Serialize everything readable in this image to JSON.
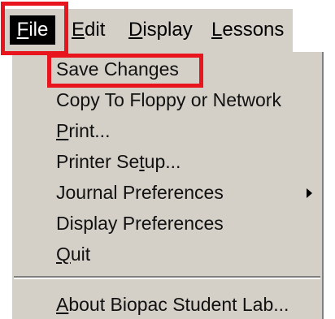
{
  "menubar": {
    "items": [
      {
        "label": "File",
        "accel_first": "F",
        "rest": "ile"
      },
      {
        "label": "Edit",
        "accel_first": "E",
        "rest": "dit"
      },
      {
        "label": "Display",
        "accel_first": "D",
        "rest": "isplay"
      },
      {
        "label": "Lessons",
        "accel_first": "L",
        "rest": "essons"
      }
    ]
  },
  "file_menu": {
    "items": [
      {
        "label": "Save Changes"
      },
      {
        "label": "Copy To Floppy or Network"
      },
      {
        "label": "Print...",
        "accel_first": "P",
        "rest": "rint..."
      },
      {
        "label": "Printer Setup...",
        "pre": "Printer Se",
        "accel": "t",
        "post": "up..."
      },
      {
        "label": "Journal Preferences",
        "submenu_icon": "submenu-arrow-icon"
      },
      {
        "label": "Display Preferences"
      },
      {
        "label": "Quit",
        "accel_first": "Q",
        "rest": "uit"
      },
      {
        "label": "About Biopac Student Lab...",
        "accel_first": "A",
        "rest": "bout Biopac Student Lab..."
      }
    ]
  },
  "highlight_color": "#e8151e"
}
